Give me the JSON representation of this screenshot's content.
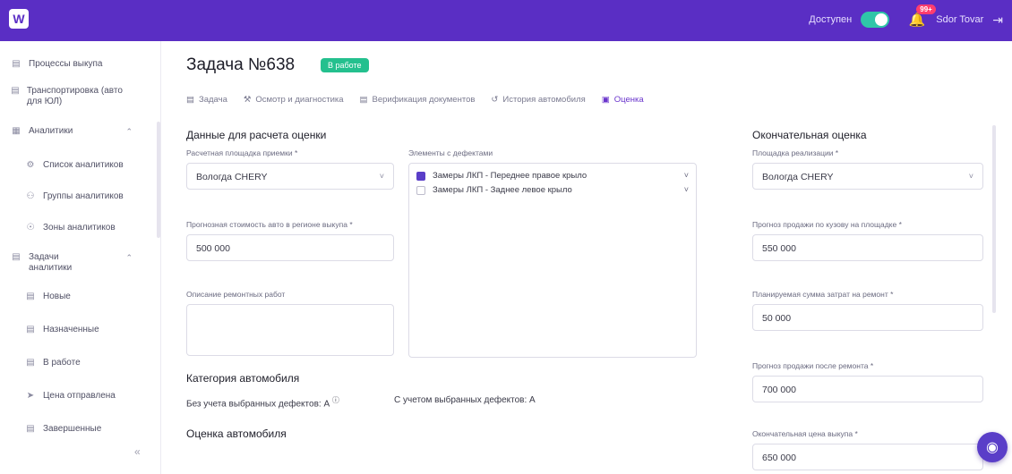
{
  "topbar": {
    "logo": "W",
    "availability_label": "Доступен",
    "notifications_count": "99+",
    "user_name": "Sdor Tovar"
  },
  "sidebar": {
    "items": [
      {
        "label": "Процессы выкупа",
        "icon": "doc-icon"
      },
      {
        "label": "Транспортировка (авто для ЮЛ)",
        "icon": "doc-icon"
      },
      {
        "label": "Аналитики",
        "icon": "grid-icon"
      },
      {
        "label": "Список аналитиков",
        "icon": "users-icon"
      },
      {
        "label": "Группы аналитиков",
        "icon": "group-icon"
      },
      {
        "label": "Зоны аналитиков",
        "icon": "pin-icon"
      },
      {
        "label": "Задачи аналитики",
        "icon": "doc-icon"
      },
      {
        "label": "Новые",
        "icon": "list-icon"
      },
      {
        "label": "Назначенные",
        "icon": "doc-icon"
      },
      {
        "label": "В работе",
        "icon": "doc-icon"
      },
      {
        "label": "Цена отправлена",
        "icon": "send-icon"
      },
      {
        "label": "Завершенные",
        "icon": "doc-icon"
      }
    ]
  },
  "page": {
    "title": "Задача №638",
    "status_badge": "В работе"
  },
  "tabs": [
    {
      "label": "Задача",
      "active": false
    },
    {
      "label": "Осмотр и диагностика",
      "active": false
    },
    {
      "label": "Верификация документов",
      "active": false
    },
    {
      "label": "История автомобиля",
      "active": false
    },
    {
      "label": "Оценка",
      "active": true
    }
  ],
  "left": {
    "section_title": "Данные для расчета оценки",
    "site_label": "Расчетная площадка приемки *",
    "site_value": "Вологда CHERY",
    "forecast_label": "Прогнозная стоимость авто в регионе выкупа *",
    "forecast_value": "500 000",
    "repair_label": "Описание ремонтных работ",
    "defects_label": "Элементы с дефектами",
    "defects": [
      {
        "label": "Замеры ЛКП - Переднее правое крыло",
        "checked": true
      },
      {
        "label": "Замеры ЛКП - Заднее левое крыло",
        "checked": false
      }
    ],
    "category_title": "Категория автомобиля",
    "category_without": "Без учета выбранных дефектов: А",
    "category_with": "С учетом выбранных дефектов: А",
    "valuation_title": "Оценка автомобиля"
  },
  "right": {
    "section_title": "Окончательная оценка",
    "realization_label": "Площадка реализации *",
    "realization_value": "Вологда CHERY",
    "body_forecast_label": "Прогноз продажи по кузову на площадке *",
    "body_forecast_value": "550 000",
    "repair_cost_label": "Планируемая сумма затрат на ремонт *",
    "repair_cost_value": "50 000",
    "after_repair_label": "Прогноз продажи после ремонта *",
    "after_repair_value": "700 000",
    "final_price_label": "Окончательная цена выкупа *",
    "final_price_value": "650 000"
  },
  "colors": {
    "accent": "#6a35cc",
    "badge": "#24c08e",
    "toggle": "#2fc6a8"
  }
}
